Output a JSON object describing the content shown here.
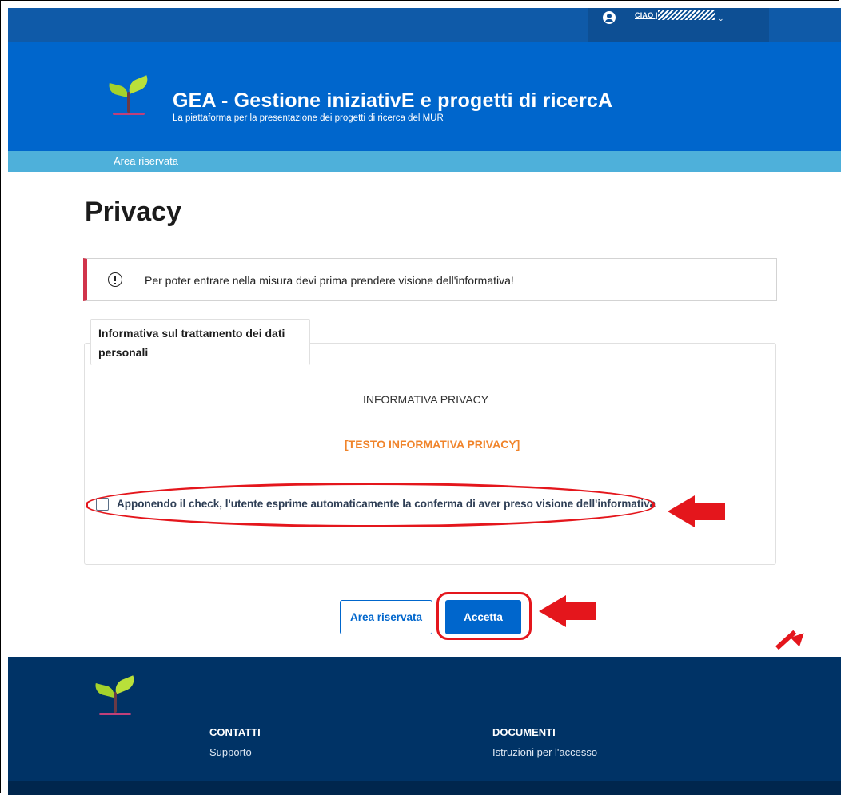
{
  "topbar": {
    "greeting": "CIAO |",
    "username": "//////////"
  },
  "header": {
    "title": "GEA - Gestione iniziativE e progetti di ricercA",
    "subtitle": "La piattaforma per la presentazione dei progetti di ricerca del MUR"
  },
  "nav": {
    "area_riservata": "Area riservata"
  },
  "page": {
    "title": "Privacy"
  },
  "alert": {
    "message": "Per poter entrare nella misura devi prima prendere visione dell'informativa!"
  },
  "card": {
    "tab_title": "Informativa sul trattamento dei dati personali",
    "heading": "INFORMATIVA PRIVACY",
    "placeholder": "[TESTO INFORMATIVA PRIVACY]",
    "checkbox_label": "Apponendo il check, l'utente esprime automaticamente la conferma di aver preso visione dell'informativa",
    "checkbox_checked": false
  },
  "buttons": {
    "back_label": "Area riservata",
    "accept_label": "Accetta"
  },
  "footer": {
    "contatti_title": "CONTATTI",
    "contatti_link": "Supporto",
    "documenti_title": "DOCUMENTI",
    "documenti_link": "Istruzioni per l'accesso"
  },
  "colors": {
    "primary": "#0066cc",
    "nav_strip": "#4eb0da",
    "alert_accent": "#d1344b",
    "placeholder_text": "#f0842b",
    "annotation_red": "#e4161c",
    "footer": "#003366"
  },
  "icons": [
    "user-icon",
    "logo-sprout",
    "alert-circle-icon",
    "chevron-down-icon"
  ]
}
